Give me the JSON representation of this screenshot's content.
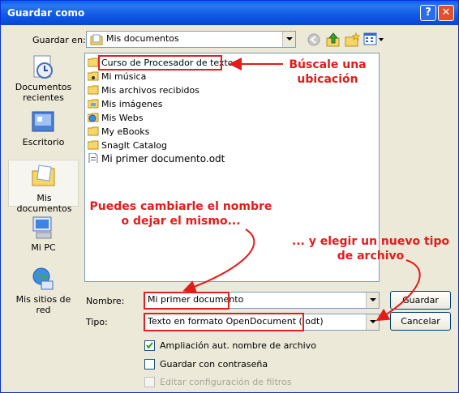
{
  "window": {
    "title": "Guardar como",
    "help_glyph": "?",
    "close_glyph": "✕"
  },
  "toolbar": {
    "location_label": "Guardar en:",
    "location_value": "Mis documentos",
    "icons": [
      "back-icon",
      "up-folder-icon",
      "new-folder-icon",
      "views-menu-icon"
    ]
  },
  "places": [
    {
      "label_line1": "Documentos",
      "label_line2": "recientes",
      "icon": "recent-documents-icon"
    },
    {
      "label_line1": "Escritorio",
      "label_line2": "",
      "icon": "desktop-icon"
    },
    {
      "label_line1": "Mis documentos",
      "label_line2": "",
      "icon": "my-documents-icon",
      "selected": true
    },
    {
      "label_line1": "Mi PC",
      "label_line2": "",
      "icon": "my-computer-icon"
    },
    {
      "label_line1": "Mis sitios de red",
      "label_line2": "",
      "icon": "network-places-icon"
    }
  ],
  "files": [
    {
      "name": "Curso de Procesador de textos",
      "icon": "folder-icon"
    },
    {
      "name": "Mi música",
      "icon": "music-folder-icon"
    },
    {
      "name": "Mis archivos recibidos",
      "icon": "folder-icon"
    },
    {
      "name": "Mis imágenes",
      "icon": "pictures-folder-icon"
    },
    {
      "name": "Mis Webs",
      "icon": "web-folder-icon"
    },
    {
      "name": "My eBooks",
      "icon": "folder-icon"
    },
    {
      "name": "SnagIt Catalog",
      "icon": "folder-icon"
    },
    {
      "name": "Mi primer documento.odt",
      "icon": "odt-document-icon"
    }
  ],
  "form": {
    "name_label": "Nombre:",
    "name_value": "Mi primer documento",
    "type_label": "Tipo:",
    "type_value": "Texto en formato OpenDocument (.odt)",
    "save_button": "Guardar",
    "cancel_button": "Cancelar",
    "opt_auto_ext": "Ampliación aut. nombre de archivo",
    "opt_auto_ext_checked": true,
    "opt_password": "Guardar con contraseña",
    "opt_password_checked": false,
    "opt_filter": "Editar configuración de filtros",
    "opt_filter_checked": false,
    "opt_filter_enabled": false
  },
  "annotations": {
    "location_line1": "Búscale una",
    "location_line2": "ubicación",
    "name_line1": "Puedes cambiarle el nombre",
    "name_line2": "o dejar el mismo...",
    "type_line1": "... y elegir un nuevo tipo",
    "type_line2": "de archivo",
    "color": "#e41b1b"
  }
}
